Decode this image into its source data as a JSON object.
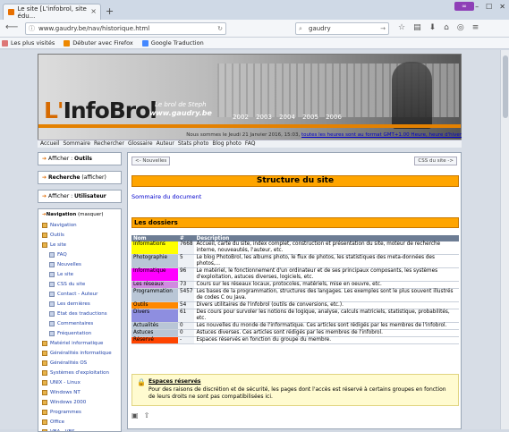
{
  "browser": {
    "tab_title": "Le site [L'infobrol, site édu...",
    "tab_close": "×",
    "new_tab": "+",
    "url": "www.gaudry.be/nav/historique.html",
    "search_value": "gaudry",
    "bookmarks": [
      "Les plus visités",
      "Débuter avec Firefox",
      "Google Traduction"
    ]
  },
  "banner": {
    "logo_prefix": "L'",
    "logo_rest": "InfoBrol",
    "tagline": "Le brol de Steph",
    "site": "www.gaudry.be",
    "years": [
      "2002",
      "2003",
      "2004",
      "2005",
      "2006"
    ]
  },
  "date_line": {
    "prefix": "Nous sommes le Jeudi 21 Janvier 2016, 15:03,",
    "link": "toutes les heures sont au format GMT+1.00 Heure, heure d'hiver"
  },
  "menu": [
    "Accueil",
    "Sommaire",
    "Rechercher",
    "Glossaire",
    "Auteur",
    "Stats photo",
    "Blog photo",
    "FAQ"
  ],
  "left": {
    "boxes": [
      {
        "prefix": "Afficher : ",
        "bold": "Outils",
        "suffix": ""
      },
      {
        "prefix": "",
        "bold": "Recherche",
        "suffix": " (afficher)"
      },
      {
        "prefix": "Afficher : ",
        "bold": "Utilisateur",
        "suffix": ""
      }
    ],
    "nav_title": "Navigation",
    "nav_toggle": " (masquer)",
    "nav_items": [
      {
        "label": "Navigation",
        "sub": false
      },
      {
        "label": "Outils",
        "sub": false
      },
      {
        "label": "Le site",
        "sub": false
      },
      {
        "label": "FAQ",
        "sub": true
      },
      {
        "label": "Nouvelles",
        "sub": true
      },
      {
        "label": "Le site",
        "sub": true
      },
      {
        "label": "CSS du site",
        "sub": true
      },
      {
        "label": "Contact - Auteur",
        "sub": true
      },
      {
        "label": "Les dernières",
        "sub": true
      },
      {
        "label": "Etat des traductions",
        "sub": true
      },
      {
        "label": "Commentaires",
        "sub": true
      },
      {
        "label": "Fréquentation",
        "sub": true
      },
      {
        "label": "Matériel informatique",
        "sub": false
      },
      {
        "label": "Généralités informatique",
        "sub": false
      },
      {
        "label": "Généralités OS",
        "sub": false
      },
      {
        "label": "Systèmes d'exploitation",
        "sub": false
      },
      {
        "label": "UNIX - Linux",
        "sub": false
      },
      {
        "label": "Windows NT",
        "sub": false
      },
      {
        "label": "Windows 2000",
        "sub": false
      },
      {
        "label": "Programmes",
        "sub": false
      },
      {
        "label": "Office",
        "sub": false
      },
      {
        "label": "VBA - VBS",
        "sub": false
      }
    ]
  },
  "main": {
    "prev": "<- Nouvelles",
    "next": "CSS du site ->",
    "title": "Structure du site",
    "sommaire": "Sommaire du document",
    "section": "Les dossiers",
    "columns": [
      "Nom",
      "#",
      "Description"
    ],
    "rows": [
      {
        "name": "Informations",
        "n": "7668",
        "desc": "Accueil, carte du site, index complet, construction et présentation du site, moteur de recherche interne, nouveautés, l'auteur, etc.",
        "color": "#ffff00"
      },
      {
        "name": "Photographie",
        "n": "5",
        "desc": "Le blog PhotoBrol, les albums photo, le flux de photos, les statistiques des meta-données des photos,...",
        "color": "#b9c6d6"
      },
      {
        "name": "Informatique",
        "n": "96",
        "desc": "Le matériel, le fonctionnement d'un ordinateur et de ses principaux composants, les systèmes d'exploitation, astuces diverses, logiciels, etc.",
        "color": "#ff00ff"
      },
      {
        "name": "Les réseaux",
        "n": "73",
        "desc": "Cours sur les réseaux locaux, protocoles, matériels, mise en oeuvre, etc.",
        "color": "#d08be0"
      },
      {
        "name": "Programmation",
        "n": "5457",
        "desc": "Les bases de la programmation, structures des langages. Les exemples sont le plus souvent illustrés de codes C ou Java.",
        "color": "#b9c6d6"
      },
      {
        "name": "Outils",
        "n": "54",
        "desc": "Divers utilitaires de l'infobrol (outils de conversions, etc.).",
        "color": "#ff8800"
      },
      {
        "name": "Divers",
        "n": "61",
        "desc": "Des cours pour survoler les notions de logique, analyse, calculs matriciels, statistique, probabilités, etc.",
        "color": "#8e8ee0"
      },
      {
        "name": "Actualités",
        "n": "0",
        "desc": "Les nouvelles du monde de l'informatique. Ces articles sont rédigés par les membres de l'infobrol.",
        "color": "#b9c6d6"
      },
      {
        "name": "Astuces",
        "n": "0",
        "desc": "Astuces diverses. Ces articles sont rédigés par les membres de l'infobrol.",
        "color": "#b9c6d6"
      },
      {
        "name": "Réservé",
        "n": "-",
        "desc": "Espaces réservés en fonction du groupe du membre.",
        "color": "#ff4400"
      }
    ],
    "note_title": "Espaces réservés",
    "note_body": "Pour des raisons de discrétion et de sécurité, les pages dont l'accès est réservé à certains groupes en fonction de leurs droits ne sont pas compatibilisées ici."
  }
}
